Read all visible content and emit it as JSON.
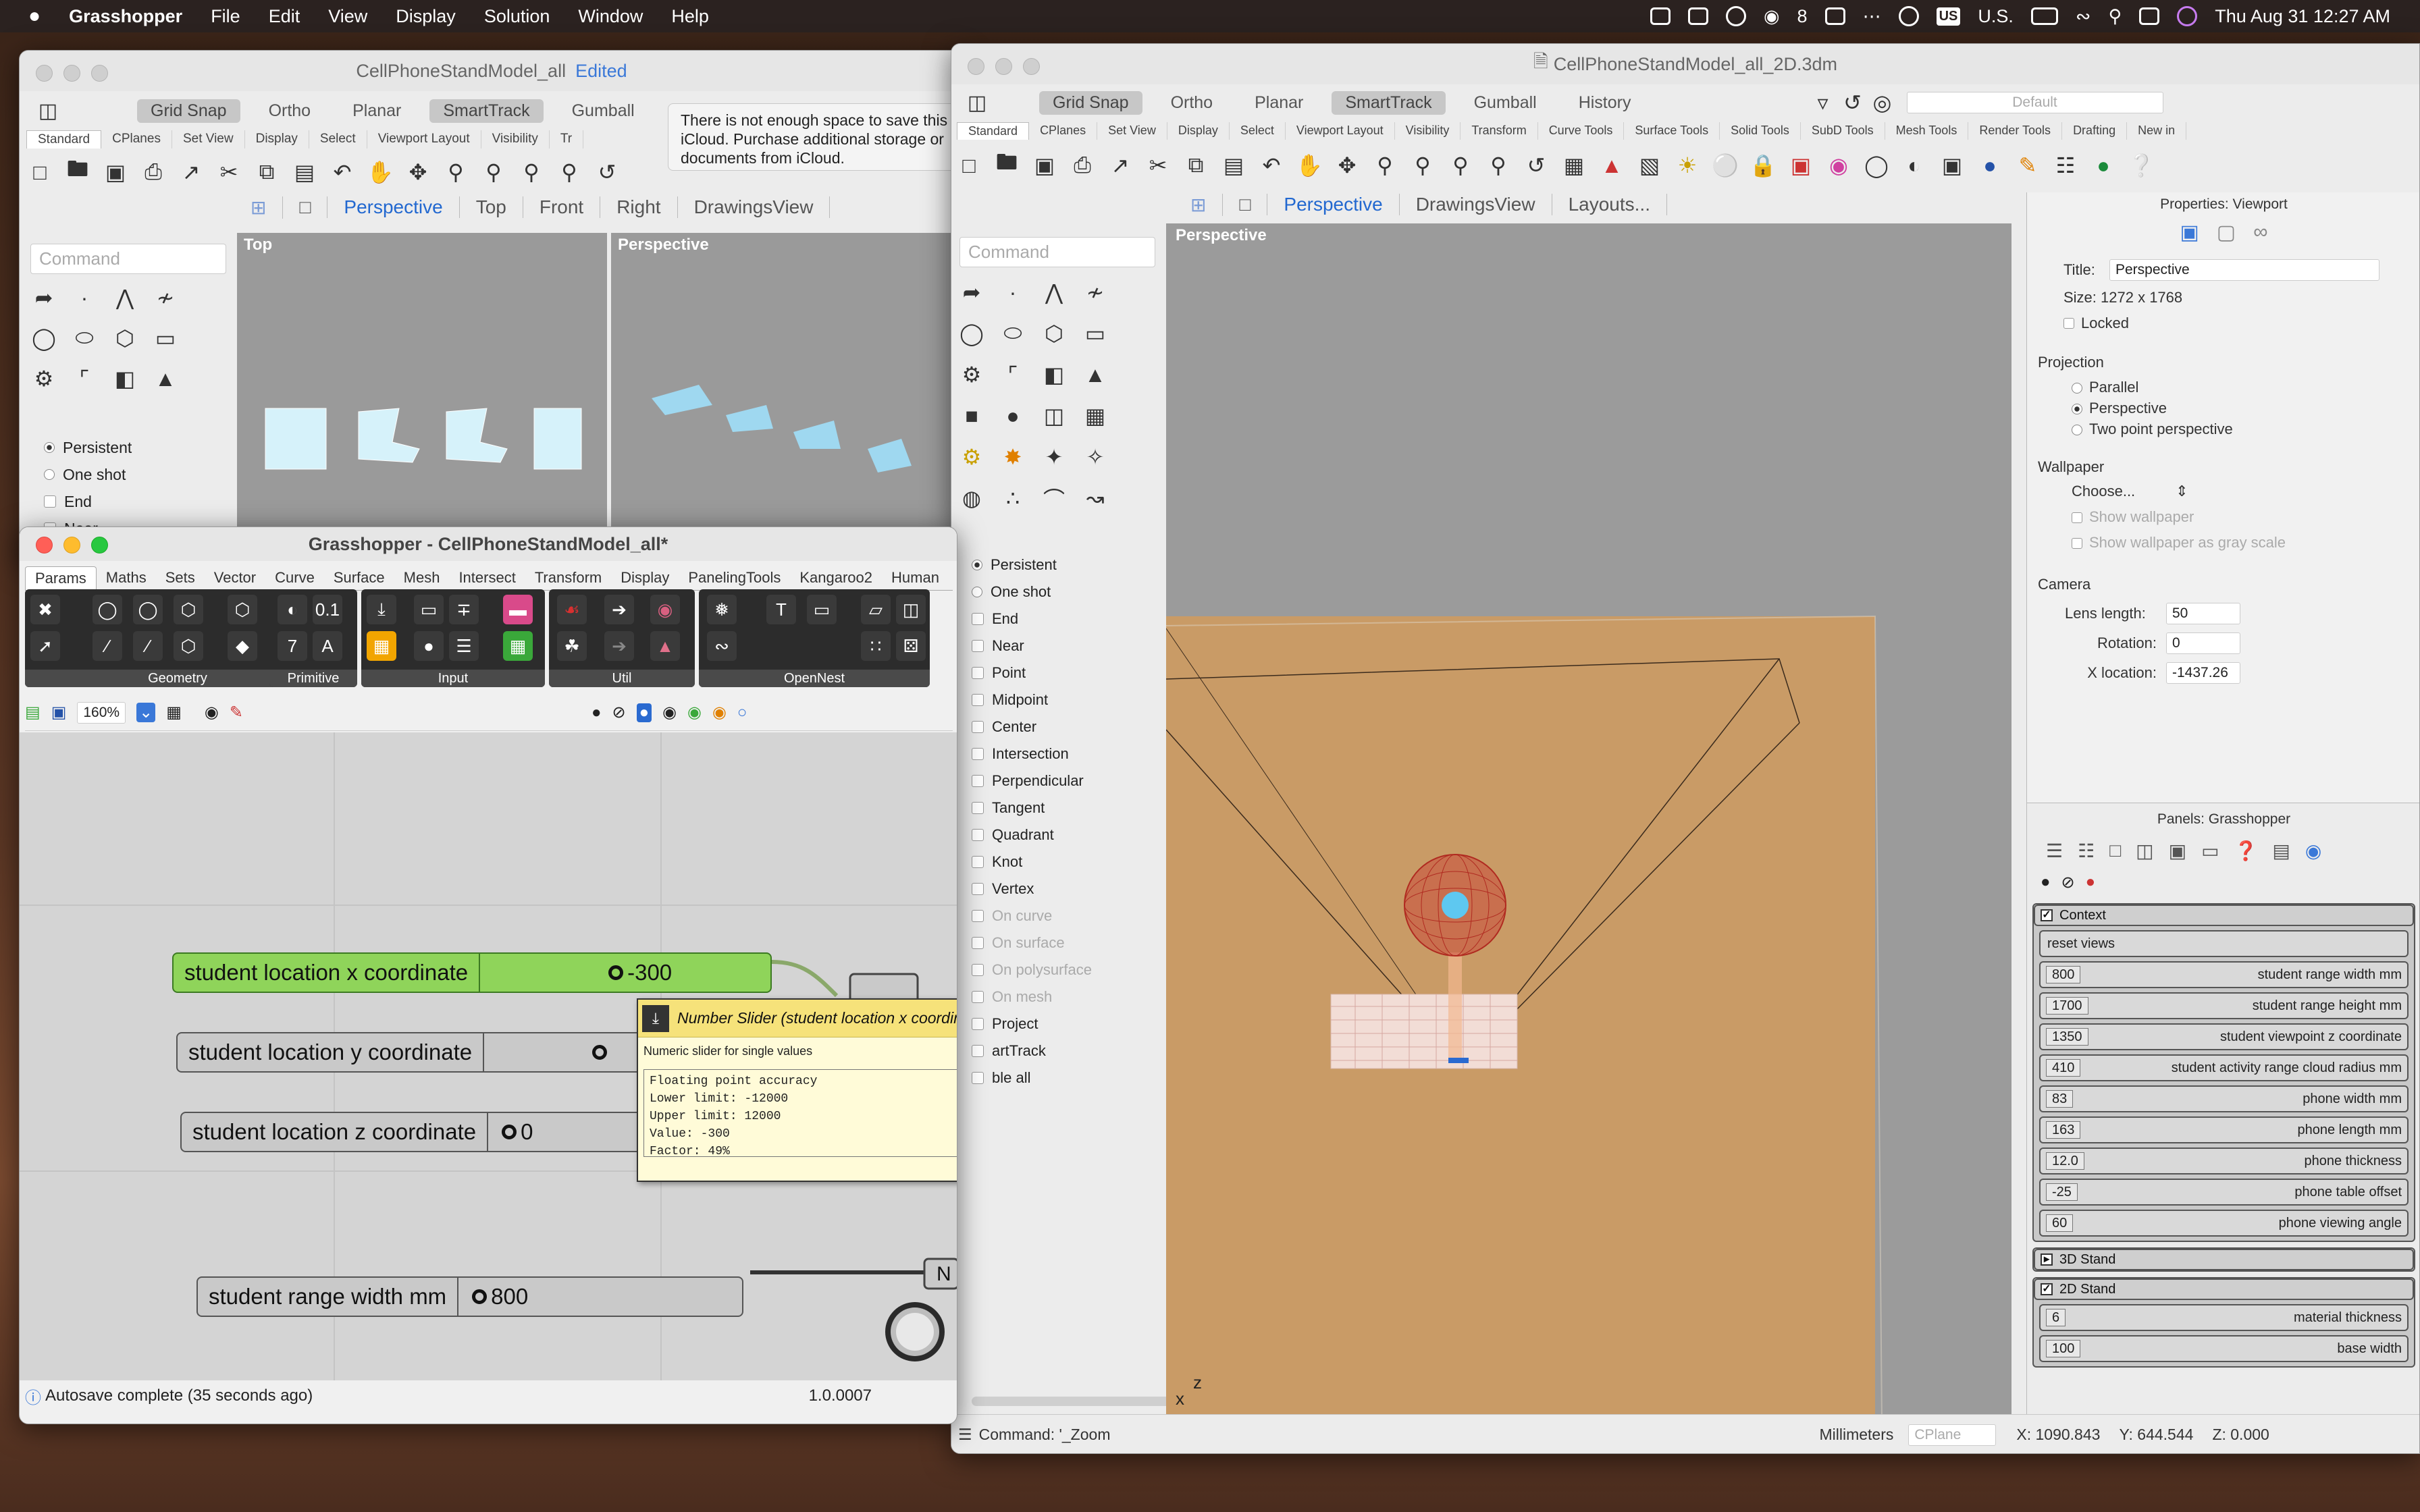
{
  "menubar": {
    "app": "Grasshopper",
    "items": [
      "File",
      "Edit",
      "View",
      "Display",
      "Solution",
      "Window",
      "Help"
    ],
    "wechat_count": "8",
    "input_source": "U.S.",
    "datetime": "Thu Aug 31  12:27 AM"
  },
  "rhino_left": {
    "title": "CellPhoneStandModel_all",
    "edited": "Edited",
    "toolbar": [
      "Grid Snap",
      "Ortho",
      "Planar",
      "SmartTrack",
      "Gumball"
    ],
    "tabs": [
      "Standard",
      "CPlanes",
      "Set View",
      "Display",
      "Select",
      "Viewport Layout",
      "Visibility",
      "Tr"
    ],
    "icloud_msg": "There is not enough space to save this iCloud. Purchase additional storage or documents from iCloud.",
    "viewtabs": [
      "Perspective",
      "Top",
      "Front",
      "Right",
      "DrawingsView"
    ],
    "command_placeholder": "Command",
    "vp_top": "Top",
    "vp_persp": "Perspective",
    "osnap": [
      "Persistent",
      "One shot",
      "End",
      "Near"
    ]
  },
  "rhino_right": {
    "title": "CellPhoneStandModel_all_2D.3dm",
    "toolbar": [
      "Grid Snap",
      "Ortho",
      "Planar",
      "SmartTrack",
      "Gumball",
      "History"
    ],
    "default_layer": "Default",
    "tabs": [
      "Standard",
      "CPlanes",
      "Set View",
      "Display",
      "Select",
      "Viewport Layout",
      "Visibility",
      "Transform",
      "Curve Tools",
      "Surface Tools",
      "Solid Tools",
      "SubD Tools",
      "Mesh Tools",
      "Render Tools",
      "Drafting",
      "New in"
    ],
    "viewtabs": [
      "Perspective",
      "DrawingsView",
      "Layouts..."
    ],
    "command_placeholder": "Command",
    "viewport_label": "Perspective",
    "osnap": [
      {
        "label": "Persistent",
        "type": "radio",
        "on": true
      },
      {
        "label": "One shot",
        "type": "radio",
        "on": false
      },
      {
        "label": "End",
        "type": "check"
      },
      {
        "label": "Near",
        "type": "check"
      },
      {
        "label": "Point",
        "type": "check"
      },
      {
        "label": "Midpoint",
        "type": "check"
      },
      {
        "label": "Center",
        "type": "check"
      },
      {
        "label": "Intersection",
        "type": "check"
      },
      {
        "label": "Perpendicular",
        "type": "check"
      },
      {
        "label": "Tangent",
        "type": "check"
      },
      {
        "label": "Quadrant",
        "type": "check"
      },
      {
        "label": "Knot",
        "type": "check"
      },
      {
        "label": "Vertex",
        "type": "check"
      },
      {
        "label": "On curve",
        "type": "check",
        "disabled": true
      },
      {
        "label": "On surface",
        "type": "check",
        "disabled": true
      },
      {
        "label": "On polysurface",
        "type": "check",
        "disabled": true
      },
      {
        "label": "On mesh",
        "type": "check",
        "disabled": true
      },
      {
        "label": "Project",
        "type": "check"
      },
      {
        "label": "artTrack",
        "type": "check"
      },
      {
        "label": "ble all",
        "type": "check"
      }
    ],
    "status": {
      "command": "Command: '_Zoom",
      "units": "Millimeters",
      "cplane": "CPlane",
      "x": "X: 1090.843",
      "y": "Y: 644.544",
      "z": "Z: 0.000"
    },
    "props": {
      "header": "Properties: Viewport",
      "title_label": "Title:",
      "title_value": "Perspective",
      "size": "Size:   1272 x 1768",
      "locked": "Locked",
      "projection": "Projection",
      "proj_options": [
        "Parallel",
        "Perspective",
        "Two point perspective"
      ],
      "wallpaper": "Wallpaper",
      "choose": "Choose...",
      "show_wallpaper": "Show wallpaper",
      "show_gray": "Show wallpaper as gray scale",
      "camera": "Camera",
      "lens_label": "Lens length:",
      "lens_value": "50",
      "rotation_label": "Rotation:",
      "rotation_value": "0",
      "xloc_label": "X location:",
      "xloc_value": "-1437.26"
    },
    "panels": {
      "header": "Panels: Grasshopper",
      "context": "Context",
      "reset_views": "reset views",
      "rows": [
        {
          "num": "800",
          "label": "student range width mm"
        },
        {
          "num": "1700",
          "label": "student range height mm"
        },
        {
          "num": "1350",
          "label": "student viewpoint z coordinate"
        },
        {
          "num": "410",
          "label": "student activity range cloud radius mm"
        },
        {
          "num": "83",
          "label": "phone width mm"
        },
        {
          "num": "163",
          "label": "phone length mm"
        },
        {
          "num": "12.0",
          "label": "phone thickness"
        },
        {
          "num": "-25",
          "label": "phone table offset"
        },
        {
          "num": "60",
          "label": "phone viewing angle"
        }
      ],
      "stand3d": "3D Stand",
      "stand2d": "2D Stand",
      "rows2d": [
        {
          "num": "6",
          "label": "material thickness"
        },
        {
          "num": "100",
          "label": "base width"
        }
      ]
    }
  },
  "grasshopper": {
    "title": "Grasshopper - CellPhoneStandModel_all*",
    "tabs": [
      "Params",
      "Maths",
      "Sets",
      "Vector",
      "Curve",
      "Surface",
      "Mesh",
      "Intersect",
      "Transform",
      "Display",
      "PanelingTools",
      "Kangaroo2",
      "Human"
    ],
    "groups": [
      "Geometry",
      "Primitive",
      "Input",
      "Util",
      "OpenNest"
    ],
    "zoom": "160%",
    "sliders": [
      {
        "label": "student location x coordinate",
        "value": "-300"
      },
      {
        "label": "student location y coordinate",
        "value": ""
      },
      {
        "label": "student location z coordinate",
        "value": "0"
      },
      {
        "label": "student range width mm",
        "value": "800"
      }
    ],
    "tooltip": {
      "title": "Number Slider (student location x coordinate)",
      "desc": "Numeric slider for single values",
      "lines": [
        "Floating point accuracy",
        "Lower limit: -12000",
        "Upper limit: 12000",
        "Value: -300",
        "Factor: 49%"
      ]
    },
    "status": "Autosave complete (35 seconds ago)",
    "version": "1.0.0007"
  },
  "colors": {
    "viewport_bg": "#9b9b9b",
    "ground": "#c99b66",
    "slider_green": "#8fd45a",
    "accent_blue": "#2268d0"
  }
}
